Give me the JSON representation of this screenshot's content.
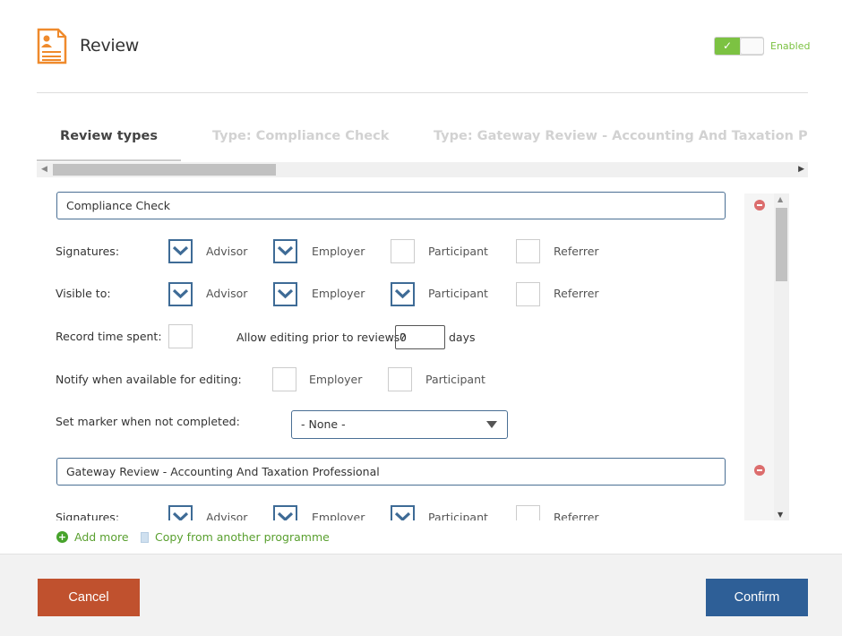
{
  "header": {
    "title": "Review",
    "toggle_mark": "✓",
    "toggle_state": "Enabled",
    "accent": "#7cc242",
    "icon": "document-user-icon"
  },
  "tabs": [
    {
      "label": "Review types",
      "active": true
    },
    {
      "label": "Type: Compliance Check",
      "active": false
    },
    {
      "label": "Type: Gateway Review - Accounting And Taxation Profess",
      "active": false
    }
  ],
  "review_types": [
    {
      "name": "Compliance Check",
      "signatures_label": "Signatures:",
      "signatures": [
        {
          "label": "Advisor",
          "checked": true
        },
        {
          "label": "Employer",
          "checked": true
        },
        {
          "label": "Participant",
          "checked": false
        },
        {
          "label": "Referrer",
          "checked": false
        }
      ],
      "visible_label": "Visible to:",
      "visible": [
        {
          "label": "Advisor",
          "checked": true
        },
        {
          "label": "Employer",
          "checked": true
        },
        {
          "label": "Participant",
          "checked": true
        },
        {
          "label": "Referrer",
          "checked": false
        }
      ],
      "record_time_label": "Record time spent:",
      "record_time_checked": false,
      "allow_editing_label": "Allow editing prior to reviews?",
      "allow_editing_days": "0",
      "days_label": "days",
      "notify_label": "Notify when available for editing:",
      "notify": [
        {
          "label": "Employer",
          "checked": false
        },
        {
          "label": "Participant",
          "checked": false
        }
      ],
      "marker_label": "Set marker when not completed:",
      "marker_value": "- None -"
    },
    {
      "name": "Gateway Review - Accounting And Taxation Professional",
      "signatures_label": "Signatures:",
      "signatures": [
        {
          "label": "Advisor",
          "checked": true
        },
        {
          "label": "Employer",
          "checked": true
        },
        {
          "label": "Participant",
          "checked": true
        },
        {
          "label": "Referrer",
          "checked": false
        }
      ]
    }
  ],
  "actions": {
    "add_more": "Add more",
    "copy": "Copy from another programme"
  },
  "footer": {
    "cancel": "Cancel",
    "confirm": "Confirm",
    "cancel_color": "#c0512e",
    "confirm_color": "#2e5f97"
  }
}
